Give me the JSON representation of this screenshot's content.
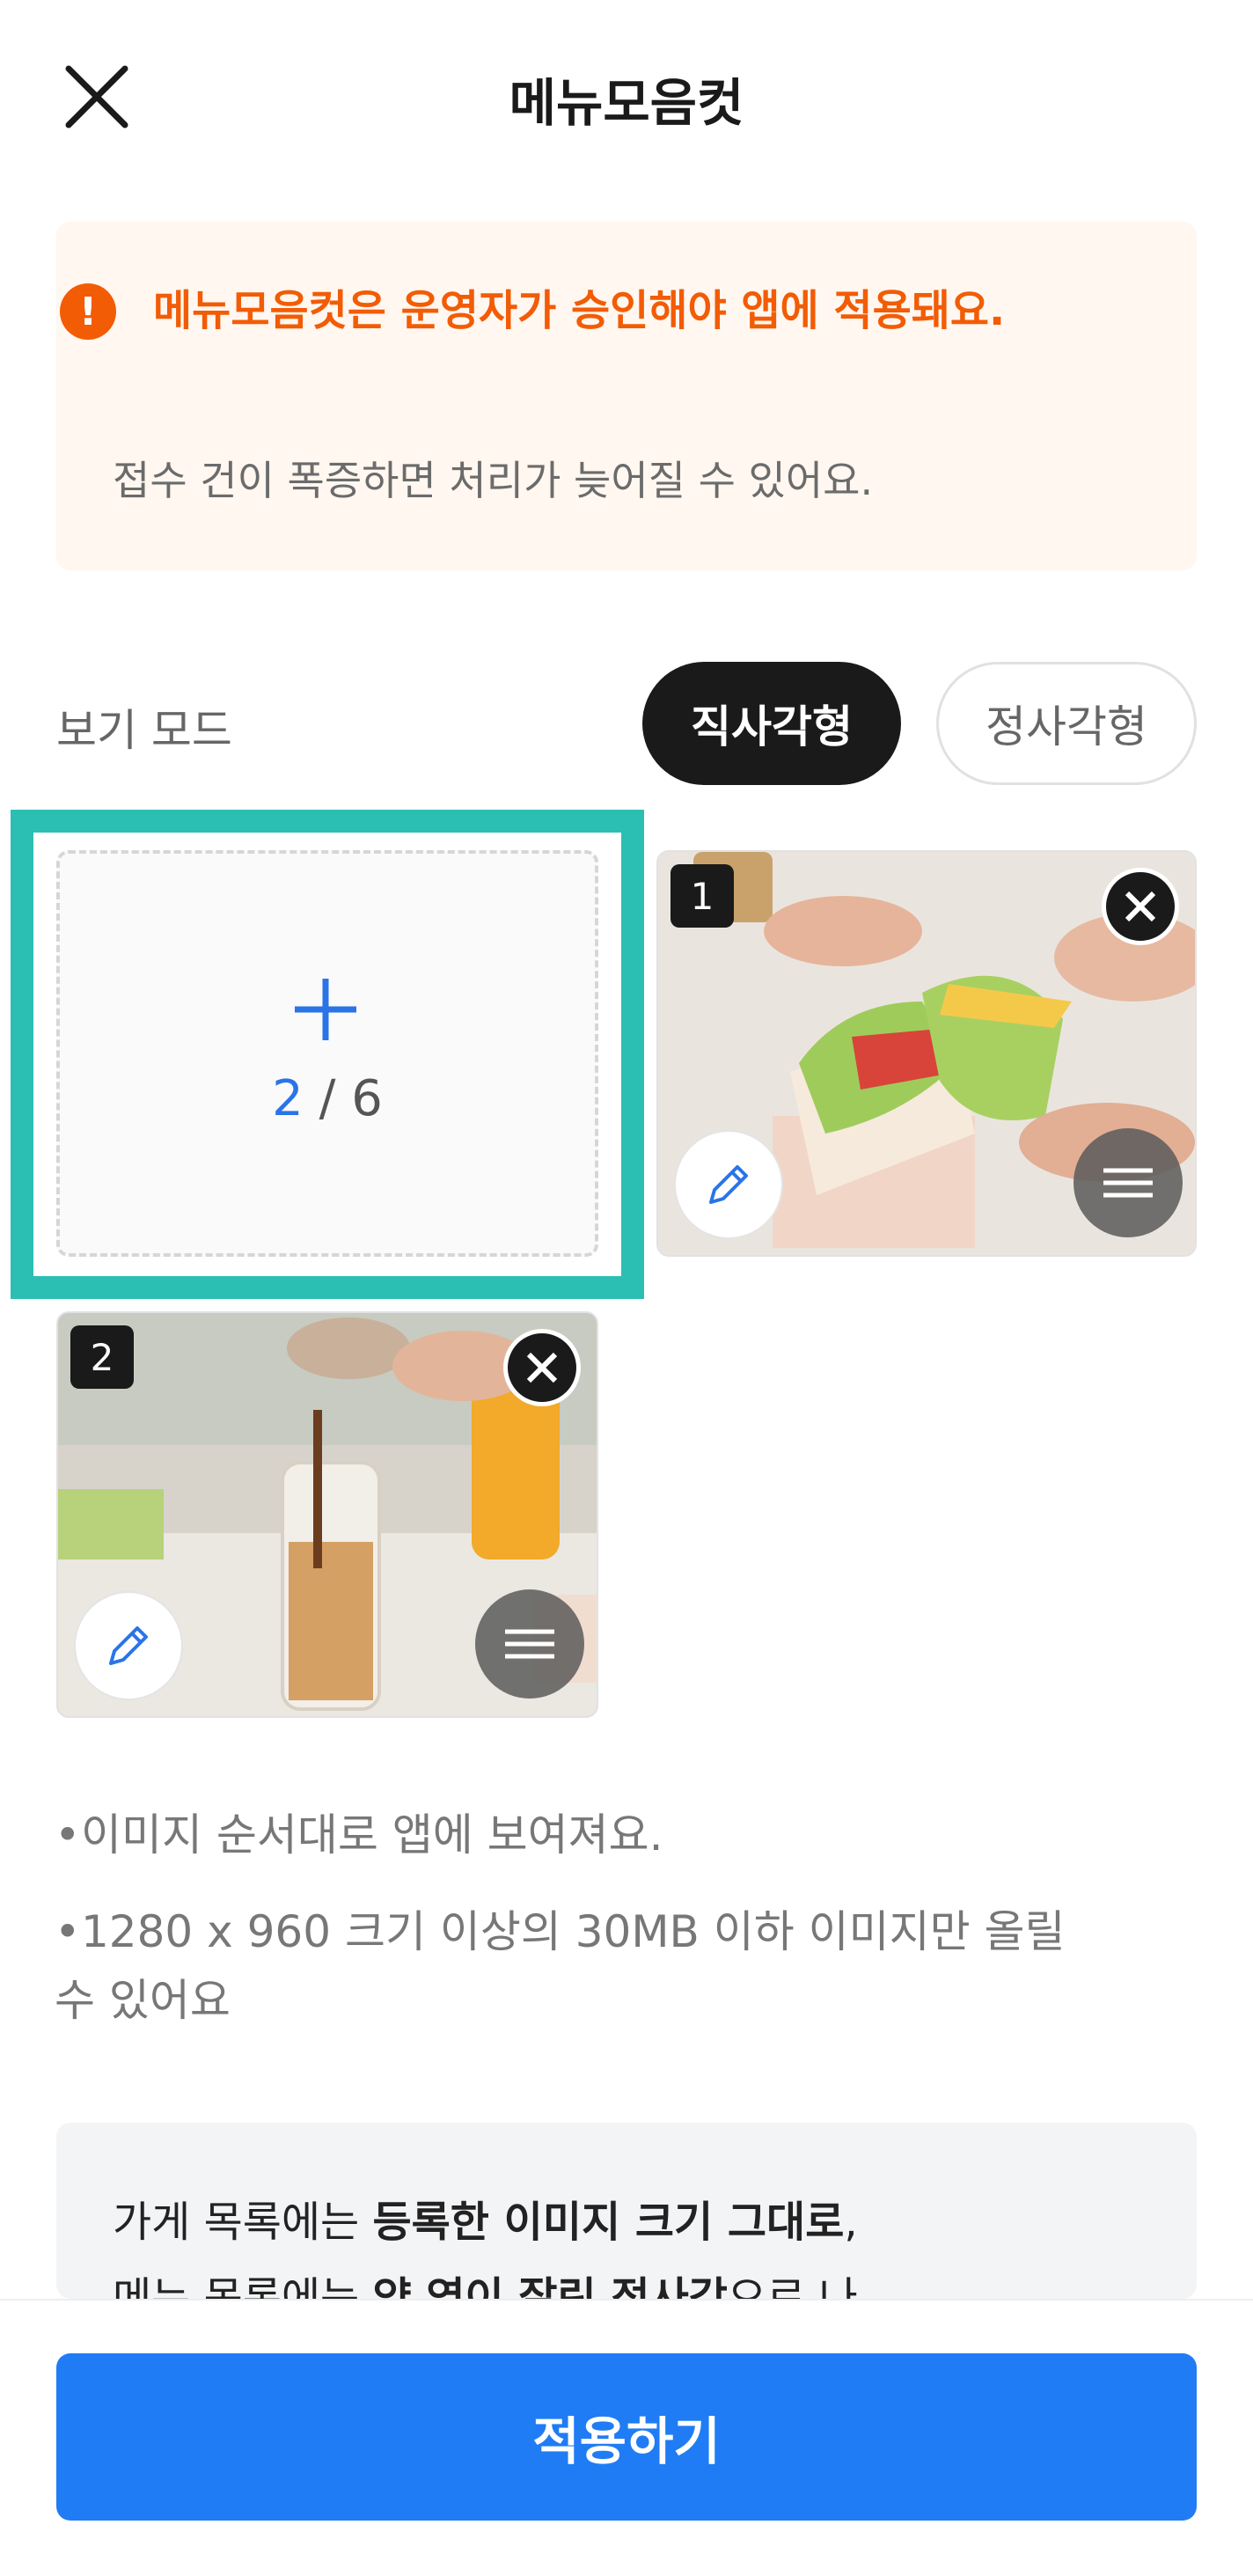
{
  "header": {
    "title": "메뉴모음컷"
  },
  "notice": {
    "title": "메뉴모음컷은 운영자가 승인해야 앱에 적용돼요.",
    "description": "접수 건이 폭증하면 처리가 늦어질 수 있어요."
  },
  "view_mode": {
    "label": "보기 모드",
    "options": [
      "직사각형",
      "정사각형"
    ],
    "selected": "직사각형"
  },
  "uploader": {
    "current": "2",
    "separator": " / ",
    "max": "6"
  },
  "photos": [
    {
      "order": "1",
      "subject": "sandwich"
    },
    {
      "order": "2",
      "subject": "iced-latte"
    }
  ],
  "guides": [
    "이미지 순서대로 앱에 보여져요.",
    "1280 x 960 크기 이상의 30MB 이하 이미지만 올릴 수 있어요"
  ],
  "info": {
    "line1_prefix": "가게 목록에는 ",
    "line1_bold": "등록한 이미지 크기 그대로",
    "line1_suffix": ",",
    "line2_prefix": "메뉴 목록에는 ",
    "line2_bold": "양 옆이 잘린 정사각",
    "line2_suffix": "으로 나"
  },
  "footer": {
    "apply_label": "적용하기"
  },
  "colors": {
    "accent": "#1f7cf5",
    "warning": "#f25c05",
    "highlight": "#2bbfb4"
  }
}
